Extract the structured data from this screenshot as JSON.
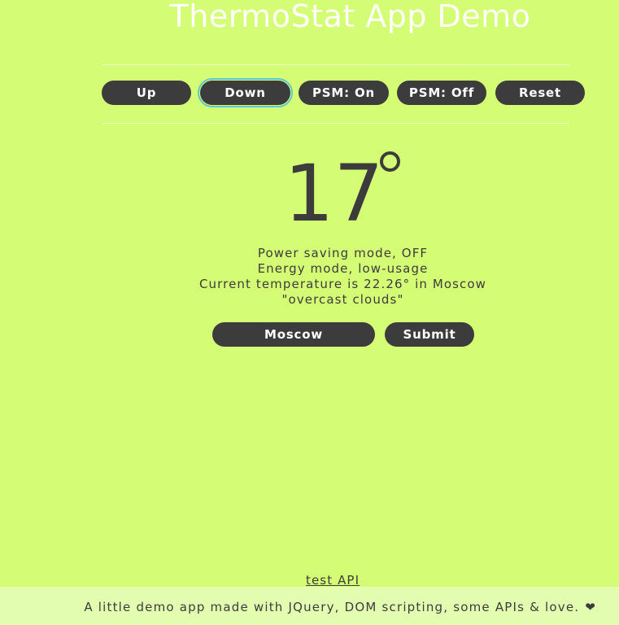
{
  "header": {
    "title": "ThermoStat App Demo"
  },
  "controls": {
    "up_label": "Up",
    "down_label": "Down",
    "psm_on_label": "PSM: On",
    "psm_off_label": "PSM: Off",
    "reset_label": "Reset"
  },
  "thermostat": {
    "temperature": "17"
  },
  "status": {
    "power_saving": "Power saving mode, OFF",
    "energy_mode": "Energy mode, low-usage",
    "current_temp": "Current temperature is 22.26° in Moscow",
    "weather_desc": "\"overcast clouds\""
  },
  "city_form": {
    "city_value": "Moscow",
    "submit_label": "Submit"
  },
  "links": {
    "test_api": "test API"
  },
  "footer": {
    "text": "A little demo app made with JQuery, DOM scripting, some APIs & love.",
    "heart_glyph": "❤"
  },
  "colors": {
    "background": "#d4fc74",
    "button": "#3c3c3c",
    "title": "#ffffff",
    "focus_ring": "#5fc6d3",
    "footer_bg": "#e3fdb0"
  },
  "icons": {
    "degree": "degree-icon",
    "heart": "heart-icon"
  }
}
